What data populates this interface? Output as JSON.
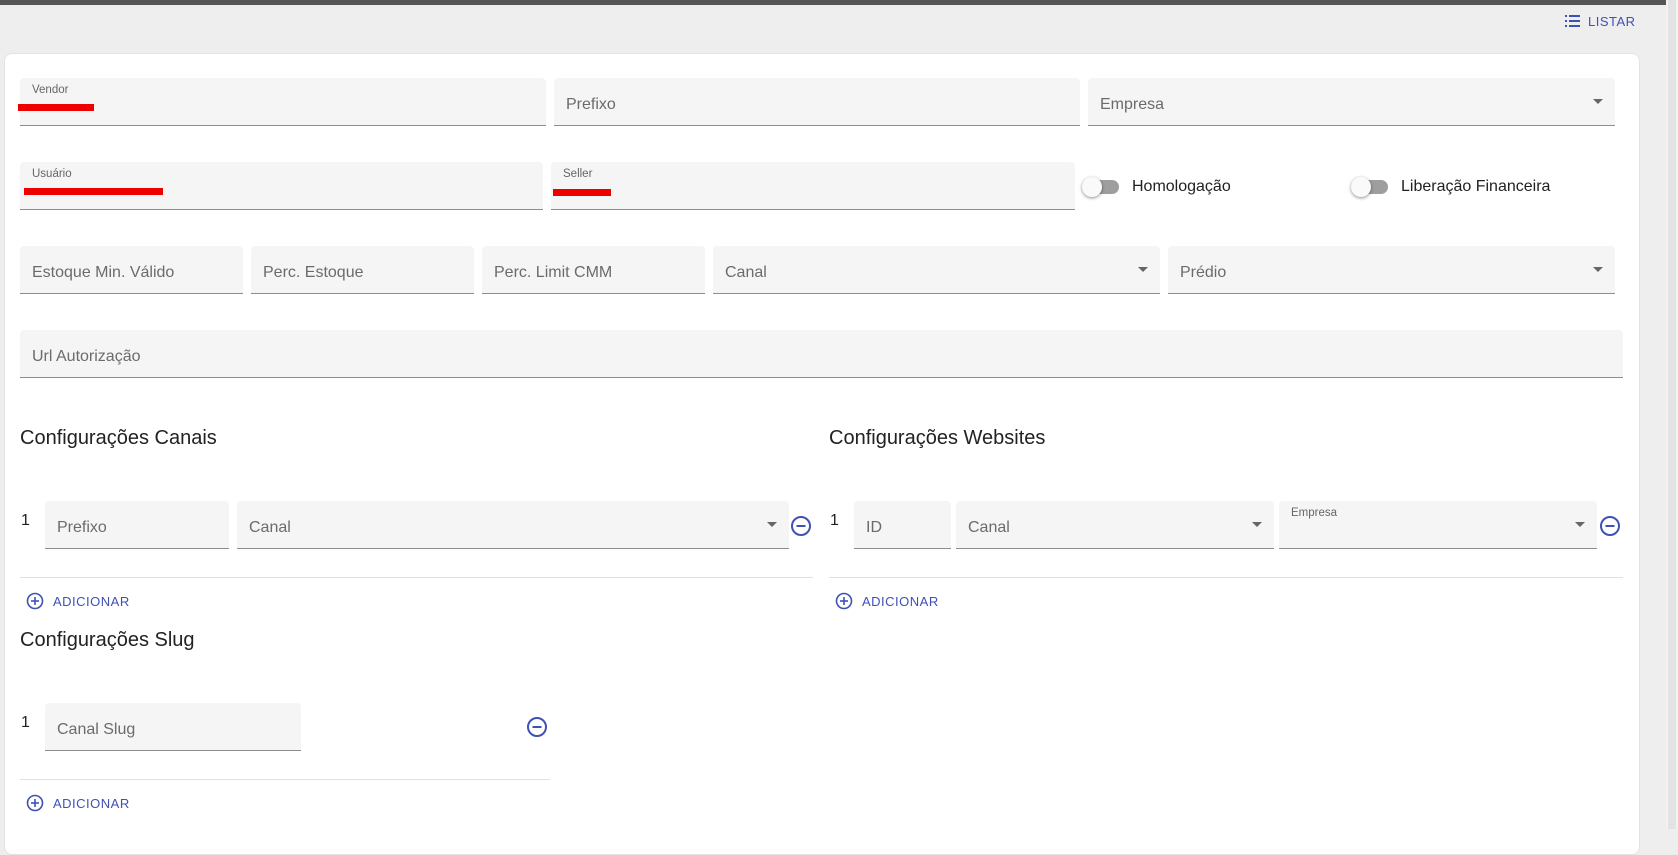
{
  "toolbar": {
    "listar_label": "LISTAR",
    "listar_icon": "list-icon"
  },
  "form": {
    "vendor": {
      "label": "Vendor",
      "value": ""
    },
    "prefixo": {
      "label": "Prefixo"
    },
    "empresa": {
      "label": "Empresa"
    },
    "usuario": {
      "label": "Usuário",
      "value": ""
    },
    "seller": {
      "label": "Seller",
      "value": ""
    },
    "homologacao": {
      "label": "Homologação",
      "checked": false
    },
    "liberacao": {
      "label": "Liberação Financeira",
      "checked": false
    },
    "estoque_min": {
      "label": "Estoque Min. Válido"
    },
    "perc_estoque": {
      "label": "Perc. Estoque"
    },
    "perc_limit": {
      "label": "Perc. Limit CMM"
    },
    "canal": {
      "label": "Canal"
    },
    "predio": {
      "label": "Prédio"
    },
    "url_autorizacao": {
      "label": "Url Autorização"
    }
  },
  "canais": {
    "title": "Configurações Canais",
    "rows": [
      {
        "index": "1",
        "prefixo_label": "Prefixo",
        "canal_label": "Canal"
      }
    ],
    "add_label": "ADICIONAR"
  },
  "websites": {
    "title": "Configurações Websites",
    "rows": [
      {
        "index": "1",
        "id_label": "ID",
        "canal_label": "Canal",
        "empresa_label": "Empresa"
      }
    ],
    "add_label": "ADICIONAR"
  },
  "slug": {
    "title": "Configurações Slug",
    "rows": [
      {
        "index": "1",
        "canal_slug_label": "Canal Slug"
      }
    ],
    "add_label": "ADICIONAR"
  },
  "colors": {
    "accent": "#3f51b5",
    "redaction": "#ee0000"
  }
}
